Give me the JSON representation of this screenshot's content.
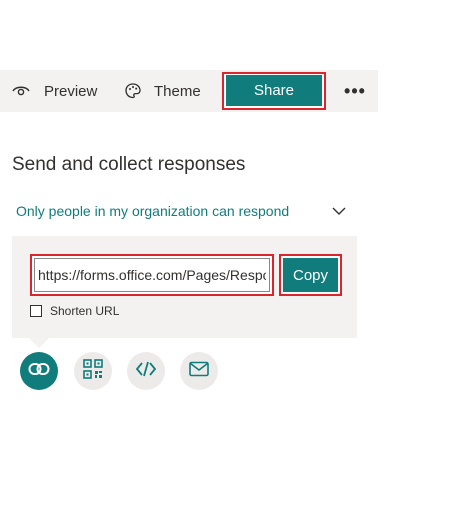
{
  "toolbar": {
    "preview_label": "Preview",
    "preview_icon": "eye-icon",
    "theme_label": "Theme",
    "theme_icon": "palette-icon",
    "share_label": "Share",
    "more_label": "•••"
  },
  "share_panel": {
    "heading": "Send and collect responses",
    "audience_dropdown": {
      "selected": "Only people in my organization can respond",
      "icon": "chevron-down-icon"
    },
    "link": {
      "url_value": "https://forms.office.com/Pages/Respon",
      "copy_label": "Copy",
      "shorten_label": "Shorten URL",
      "shorten_checked": false
    },
    "share_options": [
      {
        "icon": "link-icon",
        "active": true
      },
      {
        "icon": "qr-code-icon",
        "active": false
      },
      {
        "icon": "embed-code-icon",
        "active": false
      },
      {
        "icon": "mail-icon",
        "active": false
      }
    ]
  },
  "colors": {
    "accent": "#107c7b",
    "highlight_outline": "#d9262c",
    "panel_bg": "#f3f2f1",
    "dropdown_text": "#107c7b"
  }
}
